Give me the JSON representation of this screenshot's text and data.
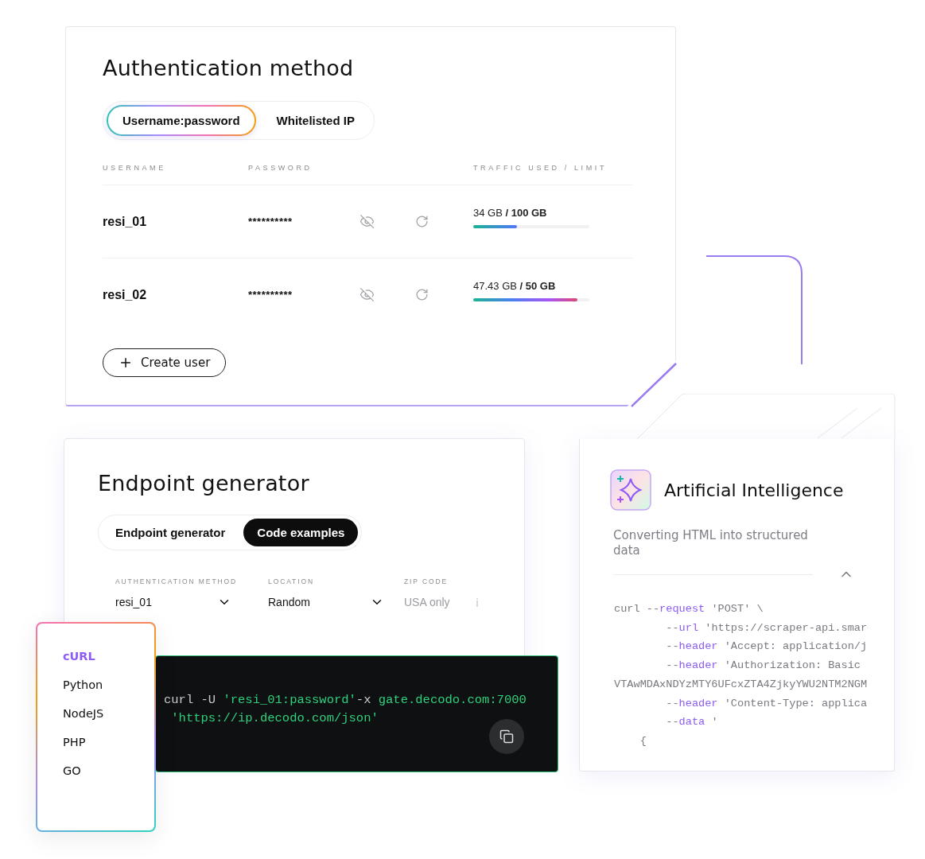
{
  "auth_card": {
    "title": "Authentication method",
    "tabs": [
      {
        "label": "Username:password",
        "selected": true
      },
      {
        "label": "Whitelisted IP",
        "selected": false
      }
    ],
    "columns": [
      "USERNAME",
      "PASSWORD",
      "TRAFFIC USED / LIMIT"
    ],
    "users": [
      {
        "username": "resi_01",
        "password": "**********",
        "used": "34 GB",
        "limit": "/ 100 GB",
        "level": 0.38
      },
      {
        "username": "resi_02",
        "password": "**********",
        "used": "47.43 GB",
        "limit": "/ 50 GB",
        "level": 0.9
      }
    ],
    "create_button": "Create user"
  },
  "endpoint_card": {
    "title": "Endpoint generator",
    "tabs": [
      {
        "label": "Endpoint generator",
        "selected": false
      },
      {
        "label": "Code examples",
        "selected": true
      }
    ],
    "fields": [
      {
        "kind": "select",
        "label": "AUTHENTICATION METHOD",
        "value": "resi_01"
      },
      {
        "kind": "select",
        "label": "LOCATION",
        "value": "Random"
      },
      {
        "kind": "input",
        "label": "ZIP CODE",
        "placeholder": "USA only"
      }
    ]
  },
  "language_menu": [
    {
      "label": "cURL",
      "selected": true
    },
    {
      "label": "Python",
      "selected": false
    },
    {
      "label": "NodeJS",
      "selected": false
    },
    {
      "label": "PHP",
      "selected": false
    },
    {
      "label": "GO",
      "selected": false
    }
  ],
  "code_block": [
    [
      {
        "kind": "plain",
        "text": "curl -U "
      },
      {
        "kind": "string",
        "text": "'resi_01:password'"
      },
      {
        "kind": "plain",
        "text": "-x "
      },
      {
        "kind": "string",
        "text": "gate.decodo.com:7000"
      }
    ],
    [
      {
        "kind": "string",
        "text": " 'https://ip.decodo.com/json'"
      }
    ]
  ],
  "ai_card": {
    "title": "Artificial Intelligence",
    "subtitle": "Converting HTML into structured data",
    "code": [
      [
        {
          "kind": "plain",
          "text": "curl --"
        },
        {
          "kind": "flag",
          "text": "request"
        },
        {
          "kind": "plain",
          "text": " 'POST' \\"
        }
      ],
      [
        {
          "kind": "plain",
          "text": "        --"
        },
        {
          "kind": "flag",
          "text": "url"
        },
        {
          "kind": "plain",
          "text": " 'https://scraper-api.smar"
        }
      ],
      [
        {
          "kind": "plain",
          "text": "        --"
        },
        {
          "kind": "flag",
          "text": "header"
        },
        {
          "kind": "plain",
          "text": " 'Accept: application/j"
        }
      ],
      [
        {
          "kind": "plain",
          "text": "        --"
        },
        {
          "kind": "flag",
          "text": "header"
        },
        {
          "kind": "plain",
          "text": " 'Authorization: Basic"
        }
      ],
      [
        {
          "kind": "plain",
          "text": "VTAwMDAxNDYzMTY6UFcxZTA4ZjkyYWU2NTM2NGM"
        }
      ],
      [
        {
          "kind": "plain",
          "text": "        --"
        },
        {
          "kind": "flag",
          "text": "header"
        },
        {
          "kind": "plain",
          "text": " 'Content-Type: applica"
        }
      ],
      [
        {
          "kind": "plain",
          "text": "        --"
        },
        {
          "kind": "flag",
          "text": "data"
        },
        {
          "kind": "plain",
          "text": " '"
        }
      ],
      [
        {
          "kind": "plain",
          "text": "    {"
        }
      ]
    ]
  }
}
